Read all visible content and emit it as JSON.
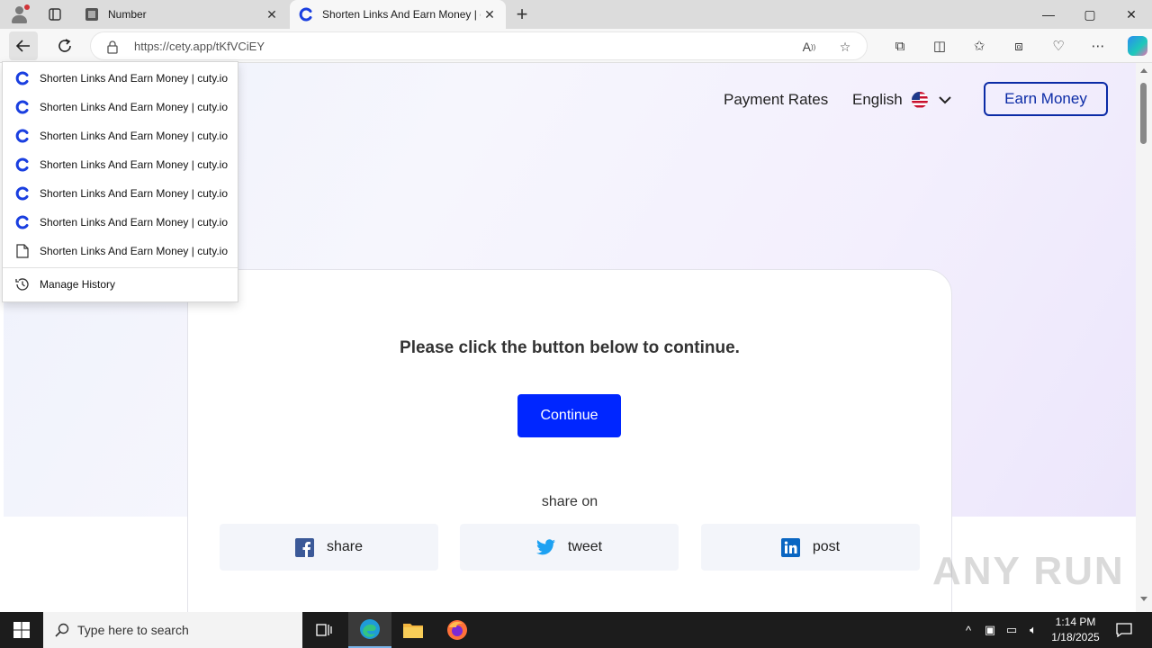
{
  "browser": {
    "tabs": [
      {
        "title": "Number",
        "active": false
      },
      {
        "title": "Shorten Links And Earn Money | c",
        "active": true
      }
    ],
    "new_tab_symbol": "+",
    "url": "https://cety.app/tKfVCiEY",
    "window_controls": {
      "minimize": "—",
      "maximize": "▢",
      "close": "✕"
    }
  },
  "history_menu": {
    "items": [
      {
        "label": "Shorten Links And Earn Money | cuty.io",
        "icon": "cuty-favicon"
      },
      {
        "label": "Shorten Links And Earn Money | cuty.io",
        "icon": "cuty-favicon"
      },
      {
        "label": "Shorten Links And Earn Money | cuty.io",
        "icon": "cuty-favicon"
      },
      {
        "label": "Shorten Links And Earn Money | cuty.io",
        "icon": "cuty-favicon"
      },
      {
        "label": "Shorten Links And Earn Money | cuty.io",
        "icon": "cuty-favicon"
      },
      {
        "label": "Shorten Links And Earn Money | cuty.io",
        "icon": "cuty-favicon"
      },
      {
        "label": "Shorten Links And Earn Money | cuty.io",
        "icon": "page-icon"
      }
    ],
    "manage_label": "Manage History"
  },
  "page": {
    "nav": {
      "payment_rates": "Payment Rates",
      "language": "English",
      "earn_money": "Earn Money"
    },
    "card": {
      "message": "Please click the button below to continue.",
      "continue_label": "Continue",
      "share_on": "share on",
      "share": [
        {
          "label": "share",
          "network": "facebook"
        },
        {
          "label": "tweet",
          "network": "twitter"
        },
        {
          "label": "post",
          "network": "linkedin"
        }
      ]
    },
    "watermark": "ANY RUN"
  },
  "taskbar": {
    "search_placeholder": "Type here to search",
    "time": "1:14 PM",
    "date": "1/18/2025"
  },
  "colors": {
    "accent_blue": "#0026ff",
    "earn_border": "#0b2ba6",
    "cuty_blue": "#1a3fe0"
  }
}
